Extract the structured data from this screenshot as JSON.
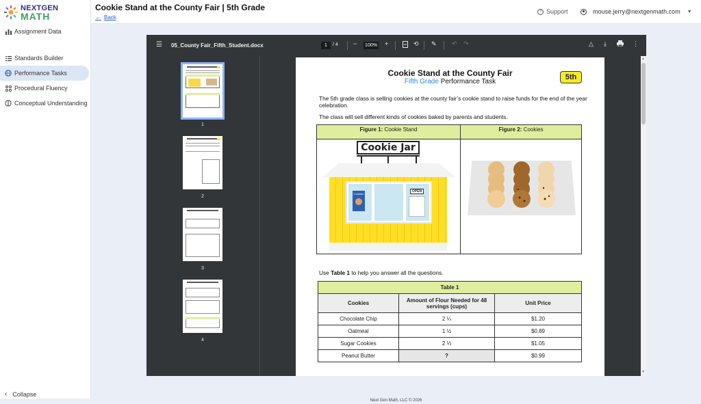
{
  "brand": {
    "line1": "NEXTGEN",
    "line2": "MATH"
  },
  "sidebar": {
    "items": [
      {
        "label": "Assignment Data",
        "icon": "bar-chart-icon"
      },
      {
        "label": "Standards Builder",
        "icon": "list-icon"
      },
      {
        "label": "Performance Tasks",
        "icon": "globe-icon",
        "active": true
      },
      {
        "label": "Procedural Fluency",
        "icon": "gear-grid-icon"
      },
      {
        "label": "Conceptual Understanding",
        "icon": "brain-icon"
      }
    ],
    "collapse_label": "Collapse"
  },
  "header": {
    "title": "Cookie Stand at the County Fair | 5th Grade",
    "back_label": "Back",
    "support_label": "Support",
    "user_email": "mouse.jerry@nextgenmath.com"
  },
  "viewer": {
    "filename": "05_County Fair_Fifth_Student.docx",
    "current_page": "1",
    "total_pages": "/ 4",
    "zoom": "100%",
    "thumbnails": [
      "1",
      "2",
      "3",
      "4"
    ]
  },
  "document": {
    "title": "Cookie Stand at the County Fair",
    "subtitle_blue": "Fifth Grade",
    "subtitle_rest": " Performance Task",
    "grade_badge": "5th",
    "para1": "The 5th grade class is selling cookies at the county fair’s cookie stand to raise funds for the end of the year celebration.",
    "para2": "The class will sell different kinds of cookies baked by parents and students.",
    "fig1_bold": "Figure 1:",
    "fig1_rest": " Cookie Stand",
    "fig2_bold": "Figure 2:",
    "fig2_rest": " Cookies",
    "sign_text": "Cookie Jar",
    "open_sign": "OPEN",
    "menu_label": "Cookies",
    "para3_pre": "Use ",
    "para3_bold": "Table 1",
    "para3_post": " to help you answer all the questions.",
    "table": {
      "caption": "Table 1",
      "headers": [
        "Cookies",
        "Amount of Flour Needed for 48 servings (cups)",
        "Unit Price"
      ],
      "rows": [
        [
          "Chocolate Chip",
          "2 ¼",
          "$1.20"
        ],
        [
          "Oatmeal",
          "1 ½",
          "$0.89"
        ],
        [
          "Sugar Cookies",
          "2 ⅓",
          "$1.05"
        ],
        [
          "Peanut Butter",
          "?",
          "$0.99"
        ]
      ]
    }
  },
  "footer": {
    "text": "Next Gen Math, LLC © 2026"
  }
}
